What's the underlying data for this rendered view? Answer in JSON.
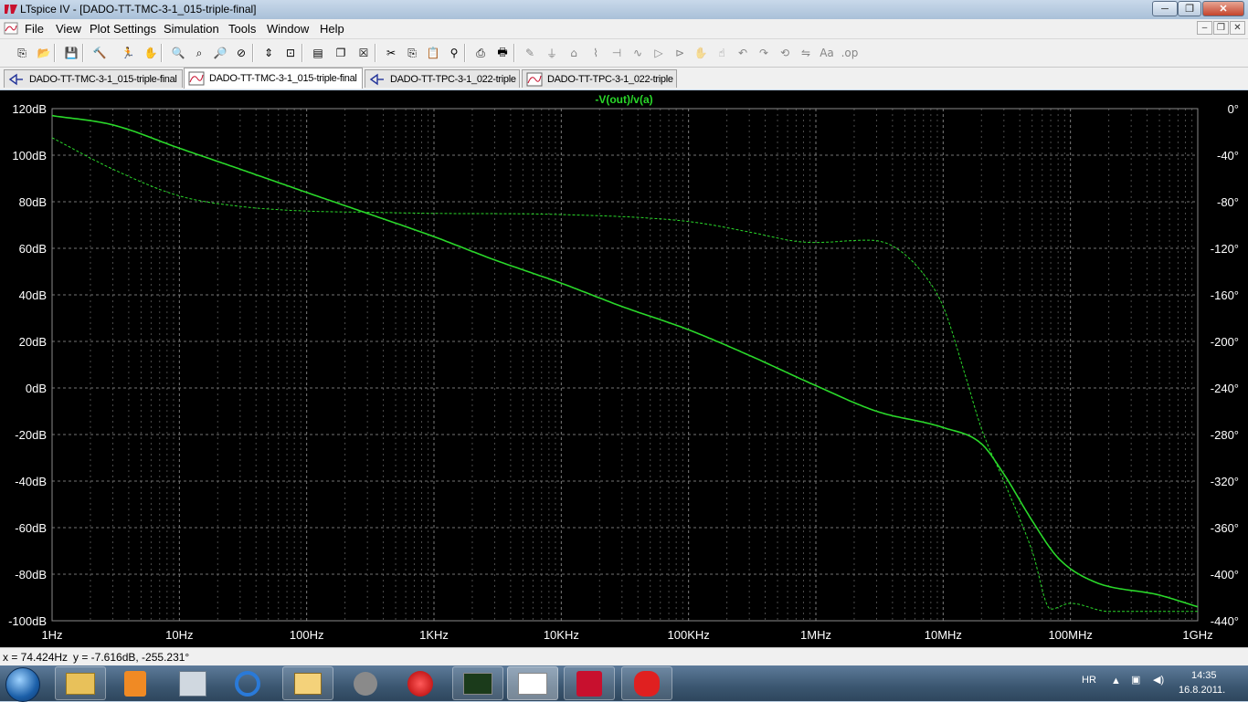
{
  "window": {
    "title": "LTspice IV - [DADO-TT-TMC-3-1_015-triple-final]",
    "controls": {
      "minimize": "─",
      "maximize": "❐",
      "close": "✕"
    }
  },
  "menu": [
    "File",
    "View",
    "Plot Settings",
    "Simulation",
    "Tools",
    "Window",
    "Help"
  ],
  "mdi_controls": {
    "minimize": "–",
    "restore": "❐",
    "close": "✕"
  },
  "toolbar": [
    "new-schematic-icon",
    "open-icon",
    "save-icon",
    "control-panel-icon",
    "run-icon",
    "halt-icon",
    "zoom-in-icon",
    "zoom-full-icon",
    "zoom-out-icon",
    "zoom-cancel-icon",
    "autoscale-icon",
    "fit-icon",
    "tile-horizontal-icon",
    "cascade-icon",
    "close-window-icon",
    "cut-icon",
    "copy-icon",
    "paste-icon",
    "find-icon",
    "print-preview-icon",
    "print-icon",
    "wire-icon",
    "ground-icon",
    "label-icon",
    "resistor-icon",
    "capacitor-icon",
    "inductor-icon",
    "diode-icon",
    "component-icon",
    "move-icon",
    "drag-icon",
    "undo-icon",
    "redo-icon",
    "rotate-icon",
    "mirror-icon",
    "text-icon",
    "spice-directive-icon"
  ],
  "tabs": [
    {
      "label": "DADO-TT-TMC-3-1_015-triple-final",
      "kind": "schematic",
      "active": false
    },
    {
      "label": "DADO-TT-TMC-3-1_015-triple-final",
      "kind": "waveform",
      "active": true
    },
    {
      "label": "DADO-TT-TPC-3-1_022-triple",
      "kind": "schematic",
      "active": false
    },
    {
      "label": "DADO-TT-TPC-3-1_022-triple",
      "kind": "waveform",
      "active": false
    }
  ],
  "colors": {
    "trace": "#2ad82a",
    "grid": "#8a8a8a",
    "background": "#000000",
    "axis_text": "#ffffff"
  },
  "chart_data": {
    "type": "line",
    "title": "-V(out)/v(a)",
    "x_scale": "log",
    "xlim": [
      1,
      1000000000
    ],
    "x_ticks": [
      {
        "value": 1,
        "label": "1Hz"
      },
      {
        "value": 10,
        "label": "10Hz"
      },
      {
        "value": 100,
        "label": "100Hz"
      },
      {
        "value": 1000,
        "label": "1KHz"
      },
      {
        "value": 10000,
        "label": "10KHz"
      },
      {
        "value": 100000,
        "label": "100KHz"
      },
      {
        "value": 1000000,
        "label": "1MHz"
      },
      {
        "value": 10000000,
        "label": "10MHz"
      },
      {
        "value": 100000000,
        "label": "100MHz"
      },
      {
        "value": 1000000000,
        "label": "1GHz"
      }
    ],
    "ylim_left": [
      -100,
      120
    ],
    "y_ticks_left": [
      {
        "value": 120,
        "label": "120dB"
      },
      {
        "value": 100,
        "label": "100dB"
      },
      {
        "value": 80,
        "label": "80dB"
      },
      {
        "value": 60,
        "label": "60dB"
      },
      {
        "value": 40,
        "label": "40dB"
      },
      {
        "value": 20,
        "label": "20dB"
      },
      {
        "value": 0,
        "label": "0dB"
      },
      {
        "value": -20,
        "label": "-20dB"
      },
      {
        "value": -40,
        "label": "-40dB"
      },
      {
        "value": -60,
        "label": "-60dB"
      },
      {
        "value": -80,
        "label": "-80dB"
      },
      {
        "value": -100,
        "label": "-100dB"
      }
    ],
    "ylim_right": [
      -440,
      0
    ],
    "y_ticks_right": [
      {
        "value": 0,
        "label": "0°"
      },
      {
        "value": -40,
        "label": "-40°"
      },
      {
        "value": -80,
        "label": "-80°"
      },
      {
        "value": -120,
        "label": "-120°"
      },
      {
        "value": -160,
        "label": "-160°"
      },
      {
        "value": -200,
        "label": "-200°"
      },
      {
        "value": -240,
        "label": "-240°"
      },
      {
        "value": -280,
        "label": "-280°"
      },
      {
        "value": -320,
        "label": "-320°"
      },
      {
        "value": -360,
        "label": "-360°"
      },
      {
        "value": -400,
        "label": "-400°"
      },
      {
        "value": -440,
        "label": "-440°"
      }
    ],
    "grid": true,
    "series": [
      {
        "axis": "left",
        "style": "solid",
        "x": [
          1,
          3,
          10,
          30,
          100,
          300,
          1000,
          3000,
          10000,
          30000,
          100000,
          300000,
          1000000,
          3000000,
          10000000,
          20000000,
          30000000,
          50000000,
          80000000,
          150000000,
          500000000,
          1000000000
        ],
        "y": [
          117,
          113,
          103,
          94,
          84,
          75,
          65,
          55,
          45,
          35,
          25,
          14,
          1,
          -10,
          -17,
          -24,
          -37,
          -57,
          -73,
          -83,
          -89,
          -94
        ]
      },
      {
        "axis": "right",
        "style": "dashed",
        "x": [
          1,
          3,
          10,
          30,
          100,
          300,
          1000,
          10000,
          100000,
          300000,
          700000,
          1000000,
          2500000,
          4000000,
          7000000,
          10000000,
          15000000,
          20000000,
          30000000,
          50000000,
          70000000,
          100000000,
          200000000,
          1000000000
        ],
        "y": [
          -25,
          -52,
          -75,
          -84,
          -88,
          -89,
          -90,
          -91,
          -97,
          -106,
          -114,
          -115,
          -113,
          -118,
          -142,
          -170,
          -230,
          -275,
          -320,
          -380,
          -430,
          -425,
          -432,
          -432
        ]
      }
    ]
  },
  "status": {
    "x": "x = 74.424Hz",
    "y": "y = -7.616dB, -255.231°"
  },
  "taskbar": {
    "apps": [
      "start-orb-icon",
      "explorer-icon",
      "media-player-icon",
      "control-panel-icon",
      "internet-explorer-icon",
      "outlook-icon",
      "app-icon",
      "opera-icon",
      "oscilloscope-icon",
      "ltspice-icon",
      "acrobat-icon",
      "paint-splat-icon"
    ],
    "lang": "HR",
    "time": "14:35",
    "date": "16.8.2011."
  }
}
